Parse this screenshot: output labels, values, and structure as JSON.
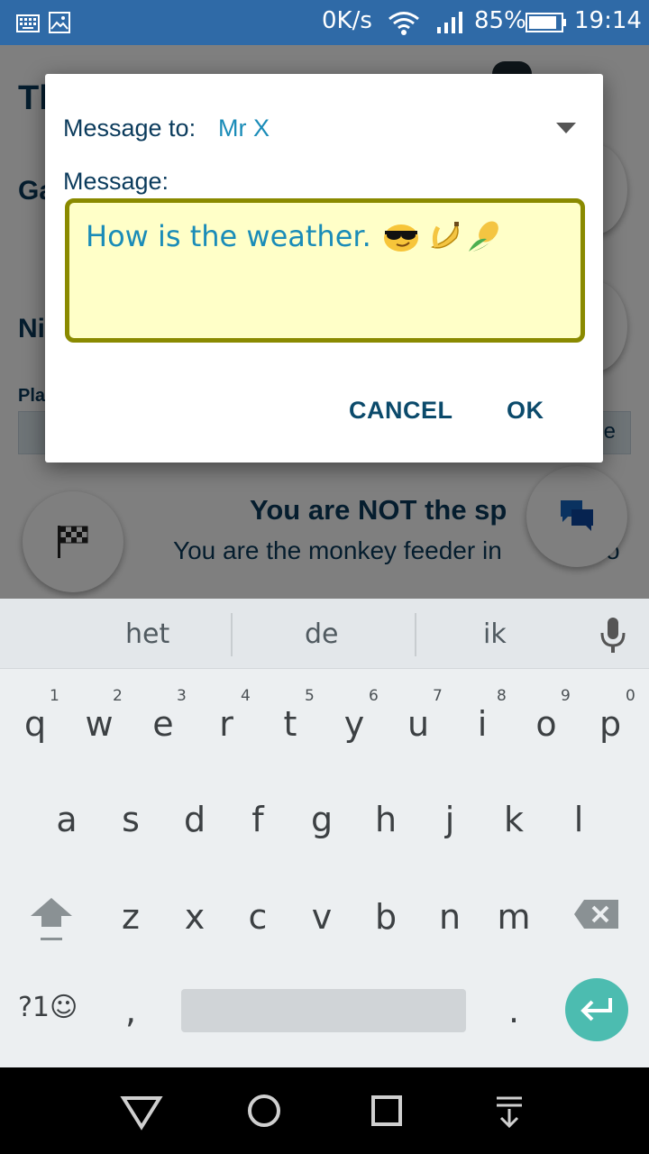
{
  "status_bar": {
    "net_speed": "0K/s",
    "battery": "85%",
    "time": "19:14"
  },
  "background": {
    "title_partial": "Th",
    "section_1_partial": "Ga",
    "section_2_partial": "Ni",
    "section_3_partial": "Pla",
    "bar_right_partial": "e",
    "status_heading": "You are NOT the sp",
    "status_detail": "You are the monkey feeder in",
    "status_detail_end": "o"
  },
  "dialog": {
    "to_label": "Message to:",
    "recipient": "Mr X",
    "message_label": "Message:",
    "message_text": "How is the weather.",
    "message_emojis": [
      "sunglasses-face",
      "banana",
      "corn"
    ],
    "cancel_label": "CANCEL",
    "ok_label": "OK",
    "box_color": "#ffffc8",
    "box_border": "#8a8a00"
  },
  "keyboard": {
    "suggestions": [
      "het",
      "de",
      "ik"
    ],
    "row1": [
      "q",
      "w",
      "e",
      "r",
      "t",
      "y",
      "u",
      "i",
      "o",
      "p"
    ],
    "row1_numbers": [
      "1",
      "2",
      "3",
      "4",
      "5",
      "6",
      "7",
      "8",
      "9",
      "0"
    ],
    "row2": [
      "a",
      "s",
      "d",
      "f",
      "g",
      "h",
      "j",
      "k",
      "l"
    ],
    "row3": [
      "z",
      "x",
      "c",
      "v",
      "b",
      "n",
      "m"
    ],
    "symbols_label": "?1☺",
    "comma": ",",
    "period": ".",
    "enter_color": "#4cbcb0"
  }
}
